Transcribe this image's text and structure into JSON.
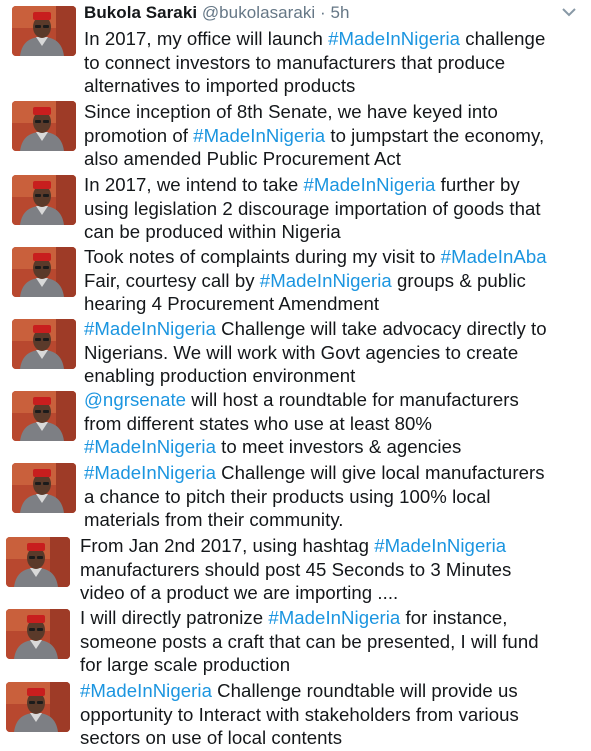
{
  "author": {
    "name": "Bukola Saraki",
    "handle": "@bukolasaraki",
    "separator": "·",
    "time": "5h"
  },
  "tweets": [
    {
      "lines": [
        [
          {
            "t": "In 2017, my office will launch "
          },
          {
            "t": "#MadeInNigeria",
            "k": "hashtag"
          },
          {
            "t": " challenge"
          }
        ],
        [
          {
            "t": "to connect investors to manufacturers that produce"
          }
        ],
        [
          {
            "t": "alternatives to imported products"
          }
        ]
      ]
    },
    {
      "lines": [
        [
          {
            "t": "Since inception of 8th Senate, we have keyed into"
          }
        ],
        [
          {
            "t": "promotion of "
          },
          {
            "t": "#MadeInNigeria",
            "k": "hashtag"
          },
          {
            "t": " to jumpstart the economy,"
          }
        ],
        [
          {
            "t": "also amended Public Procurement Act"
          }
        ]
      ]
    },
    {
      "lines": [
        [
          {
            "t": "In 2017, we intend to take "
          },
          {
            "t": "#MadeInNigeria",
            "k": "hashtag"
          },
          {
            "t": " further by"
          }
        ],
        [
          {
            "t": "using legislation 2 discourage importation of goods that"
          }
        ],
        [
          {
            "t": "can be produced within Nigeria"
          }
        ]
      ]
    },
    {
      "lines": [
        [
          {
            "t": "Took notes of complaints during my visit to "
          },
          {
            "t": "#MadeInAba",
            "k": "hashtag"
          }
        ],
        [
          {
            "t": "Fair, courtesy call by "
          },
          {
            "t": "#MadeInNigeria",
            "k": "hashtag"
          },
          {
            "t": " groups & public"
          }
        ],
        [
          {
            "t": "hearing 4 Procurement Amendment"
          }
        ]
      ]
    },
    {
      "lines": [
        [
          {
            "t": "#MadeInNigeria",
            "k": "hashtag"
          },
          {
            "t": " Challenge will take advocacy directly to"
          }
        ],
        [
          {
            "t": "Nigerians. We will work with Govt agencies to create"
          }
        ],
        [
          {
            "t": "enabling production environment"
          }
        ]
      ]
    },
    {
      "lines": [
        [
          {
            "t": "@ngrsenate",
            "k": "mention"
          },
          {
            "t": " will host a roundtable for manufacturers"
          }
        ],
        [
          {
            "t": "from different states who use at least 80%"
          }
        ],
        [
          {
            "t": "#MadeInNigeria",
            "k": "hashtag"
          },
          {
            "t": " to meet investors & agencies"
          }
        ]
      ]
    },
    {
      "lines": [
        [
          {
            "t": "#MadeInNigeria",
            "k": "hashtag"
          },
          {
            "t": " Challenge will give local manufacturers"
          }
        ],
        [
          {
            "t": "a chance to pitch their products using 100% local"
          }
        ],
        [
          {
            "t": "materials from their community."
          }
        ]
      ]
    },
    {
      "lines": [
        [
          {
            "t": "From Jan 2nd 2017, using hashtag "
          },
          {
            "t": "#MadeInNigeria",
            "k": "hashtag"
          }
        ],
        [
          {
            "t": "manufacturers should post 45 Seconds to 3 Minutes"
          }
        ],
        [
          {
            "t": "video of a product we are importing ...."
          }
        ]
      ]
    },
    {
      "lines": [
        [
          {
            "t": "I will directly patronize "
          },
          {
            "t": "#MadeInNigeria",
            "k": "hashtag"
          },
          {
            "t": " for instance,"
          }
        ],
        [
          {
            "t": "someone posts a craft that can be presented, I will fund"
          }
        ],
        [
          {
            "t": "for large scale production"
          }
        ]
      ]
    },
    {
      "lines": [
        [
          {
            "t": "#MadeInNigeria",
            "k": "hashtag"
          },
          {
            "t": " Challenge roundtable will provide us"
          }
        ],
        [
          {
            "t": "opportunity to Interact with stakeholders from various"
          }
        ],
        [
          {
            "t": "sectors on use of local contents"
          }
        ]
      ]
    }
  ],
  "icons": {
    "avatar": "profile-photo",
    "menu": "chevron-down-icon"
  },
  "colors": {
    "link": "#1b95e0",
    "text": "#14171a",
    "muted": "#657786",
    "background": "#ffffff"
  }
}
